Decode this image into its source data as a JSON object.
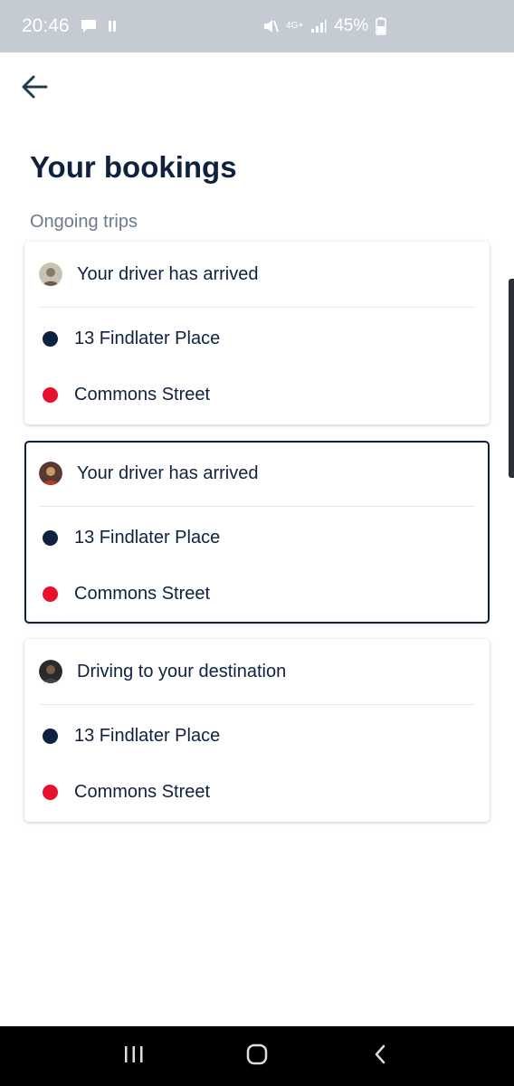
{
  "status_bar": {
    "time": "20:46",
    "battery": "45%",
    "network": "4G+",
    "icons": [
      "message-icon",
      "pause-icon",
      "mute-icon",
      "signal-icon",
      "battery-icon"
    ]
  },
  "header": {
    "back_icon": "arrow-left-icon",
    "title": "Your bookings"
  },
  "section": {
    "title": "Ongoing trips"
  },
  "bookings": [
    {
      "status": "Your driver has arrived",
      "pickup": "13 Findlater Place",
      "dropoff": "Commons Street",
      "selected": false
    },
    {
      "status": "Your driver has arrived",
      "pickup": "13 Findlater Place",
      "dropoff": "Commons Street",
      "selected": true
    },
    {
      "status": "Driving to your destination",
      "pickup": "13 Findlater Place",
      "dropoff": "Commons Street",
      "selected": false
    }
  ],
  "colors": {
    "primary": "#0e2240",
    "pickup_dot": "#0e2240",
    "dropoff_dot": "#e8112d",
    "muted": "#6b7b8c"
  },
  "nav_bar": {
    "icons": [
      "recents-icon",
      "home-icon",
      "back-icon"
    ]
  }
}
